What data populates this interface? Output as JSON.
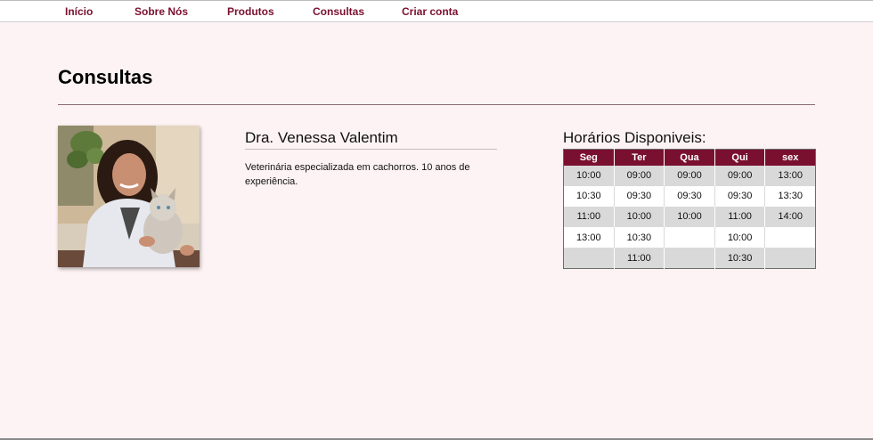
{
  "nav": {
    "items": [
      "Início",
      "Sobre Nós",
      "Produtos",
      "Consultas",
      "Criar conta"
    ]
  },
  "page": {
    "title": "Consultas"
  },
  "doctor": {
    "name": "Dra. Venessa Valentim",
    "description": "Veterinária especializada em cachorros. 10 anos de experiência."
  },
  "schedule": {
    "title": "Horários Disponiveis:",
    "headers": [
      "Seg",
      "Ter",
      "Qua",
      "Qui",
      "sex"
    ],
    "rows": [
      [
        "10:00",
        "09:00",
        "09:00",
        "09:00",
        "13:00"
      ],
      [
        "10:30",
        "09:30",
        "09:30",
        "09:30",
        "13:30"
      ],
      [
        "11:00",
        "10:00",
        "10:00",
        "11:00",
        "14:00"
      ],
      [
        "13:00",
        "10:30",
        "",
        "10:00",
        ""
      ],
      [
        "",
        "11:00",
        "",
        "10:30",
        ""
      ]
    ]
  },
  "colors": {
    "accent": "#7a1030",
    "background": "#fdf3f4"
  }
}
